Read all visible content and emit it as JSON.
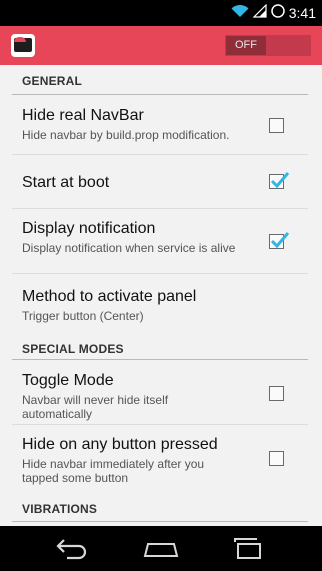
{
  "status_bar": {
    "time": "3:41"
  },
  "action_bar": {
    "toggle_label": "OFF"
  },
  "sections": [
    {
      "label": "GENERAL"
    },
    {
      "label": "SPECIAL MODES"
    },
    {
      "label": "VIBRATIONS"
    }
  ],
  "preferences": [
    {
      "title": "Hide real NavBar",
      "summary": "Hide navbar by build.prop modification.",
      "checked": false
    },
    {
      "title": "Start at boot",
      "summary": "",
      "checked": true
    },
    {
      "title": "Display notification",
      "summary": "Display notification when service is alive",
      "checked": true
    },
    {
      "title": "Method to activate panel",
      "summary": "Trigger button (Center)"
    },
    {
      "title": "Toggle Mode",
      "summary": "Navbar will never hide itself automatically",
      "checked": false
    },
    {
      "title": "Hide on any button pressed",
      "summary": "Hide navbar immediately after you tapped some button",
      "checked": false
    }
  ],
  "colors": {
    "accent": "#e64657",
    "check": "#33b5e5"
  }
}
